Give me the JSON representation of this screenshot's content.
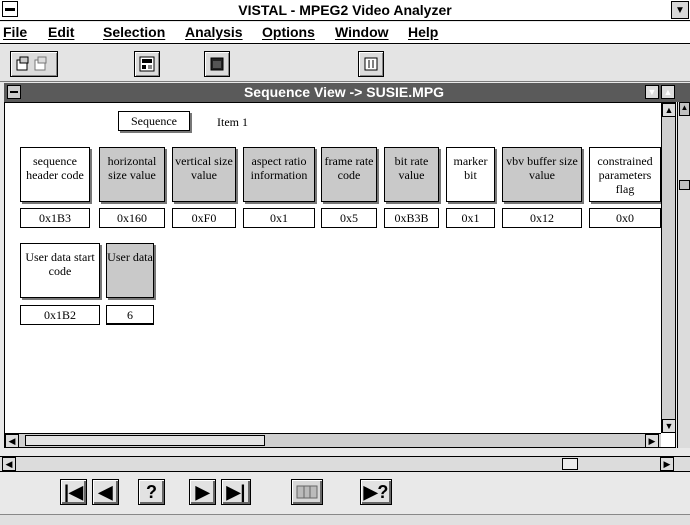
{
  "app": {
    "title": "VISTAL - MPEG2 Video Analyzer"
  },
  "menu": [
    "File",
    "Edit",
    "Selection",
    "Analysis",
    "Options",
    "Window",
    "Help"
  ],
  "child_window": {
    "title": "Sequence View -> SUSIE.MPG"
  },
  "sequence": {
    "label": "Sequence",
    "item": "Item 1"
  },
  "fields_row1": [
    {
      "label": "sequence header code",
      "value": "0x1B3"
    },
    {
      "label": "horizontal size value",
      "value": "0x160"
    },
    {
      "label": "vertical size value",
      "value": "0xF0"
    },
    {
      "label": "aspect ratio information",
      "value": "0x1"
    },
    {
      "label": "frame rate code",
      "value": "0x5"
    },
    {
      "label": "bit rate value",
      "value": "0xB3B"
    },
    {
      "label": "marker bit",
      "value": "0x1"
    },
    {
      "label": "vbv buffer size value",
      "value": "0x12"
    },
    {
      "label": "constrained parameters flag",
      "value": "0x0"
    }
  ],
  "fields_row2": [
    {
      "label": "User data start code",
      "value": "0x1B2"
    },
    {
      "label": "User data",
      "value": "6"
    }
  ],
  "nav": {
    "first": "|◀",
    "prev": "◀",
    "help": "?",
    "next": "▶",
    "last": "▶|",
    "query": "▶?"
  },
  "icons": [
    "system-menu-icon",
    "restore-icon",
    "toolbar-open-icon",
    "toolbar-grid-icon",
    "toolbar-window-icon",
    "toolbar-list-icon",
    "scroll-up-icon",
    "scroll-down-icon",
    "scroll-left-icon",
    "scroll-right-icon"
  ]
}
